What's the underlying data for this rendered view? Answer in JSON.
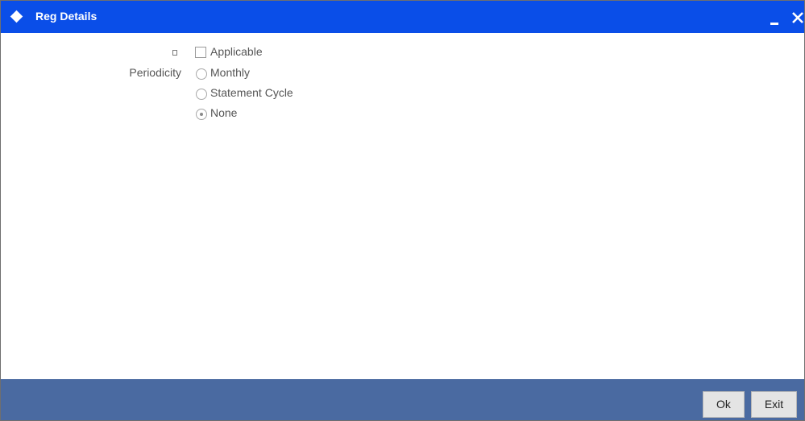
{
  "window": {
    "title": "Reg Details"
  },
  "form": {
    "applicable": {
      "label": "Applicable",
      "checked": false
    },
    "periodicity": {
      "label": "Periodicity",
      "options": [
        {
          "label": "Monthly",
          "selected": false
        },
        {
          "label": "Statement Cycle",
          "selected": false
        },
        {
          "label": "None",
          "selected": true
        }
      ]
    }
  },
  "footer": {
    "ok_label": "Ok",
    "exit_label": "Exit"
  },
  "colors": {
    "titlebar": "#0a4ee8",
    "footer": "#4a6aa1",
    "button": "#e4e4e4"
  },
  "icons": {
    "title": "diamond-icon",
    "minimize": "minimize-icon",
    "close": "close-icon"
  }
}
